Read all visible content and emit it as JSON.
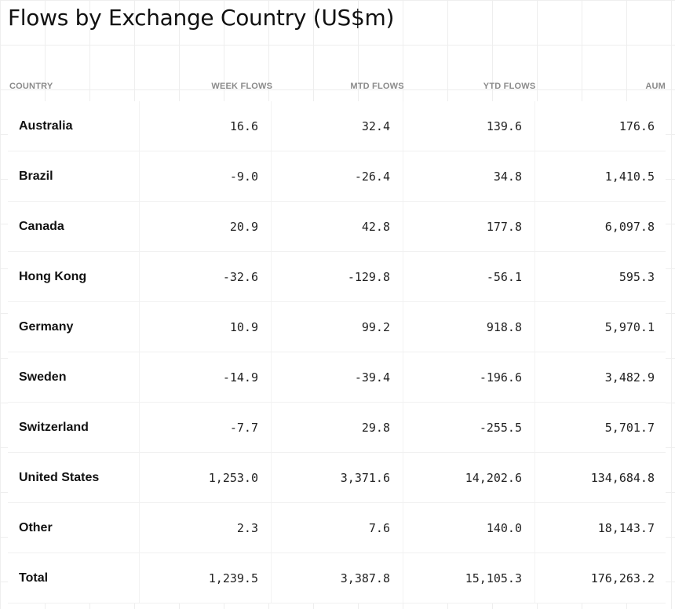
{
  "title": "Flows by Exchange Country (US$m)",
  "columns": [
    "COUNTRY",
    "WEEK FLOWS",
    "MTD FLOWS",
    "YTD FLOWS",
    "AUM"
  ],
  "rows": [
    [
      "Australia",
      "16.6",
      "32.4",
      "139.6",
      "176.6"
    ],
    [
      "Brazil",
      "-9.0",
      "-26.4",
      "34.8",
      "1,410.5"
    ],
    [
      "Canada",
      "20.9",
      "42.8",
      "177.8",
      "6,097.8"
    ],
    [
      "Hong Kong",
      "-32.6",
      "-129.8",
      "-56.1",
      "595.3"
    ],
    [
      "Germany",
      "10.9",
      "99.2",
      "918.8",
      "5,970.1"
    ],
    [
      "Sweden",
      "-14.9",
      "-39.4",
      "-196.6",
      "3,482.9"
    ],
    [
      "Switzerland",
      "-7.7",
      "29.8",
      "-255.5",
      "5,701.7"
    ],
    [
      "United States",
      "1,253.0",
      "3,371.6",
      "14,202.6",
      "134,684.8"
    ],
    [
      "Other",
      "2.3",
      "7.6",
      "140.0",
      "18,143.7"
    ],
    [
      "Total",
      "1,239.5",
      "3,387.8",
      "15,105.3",
      "176,263.2"
    ]
  ]
}
